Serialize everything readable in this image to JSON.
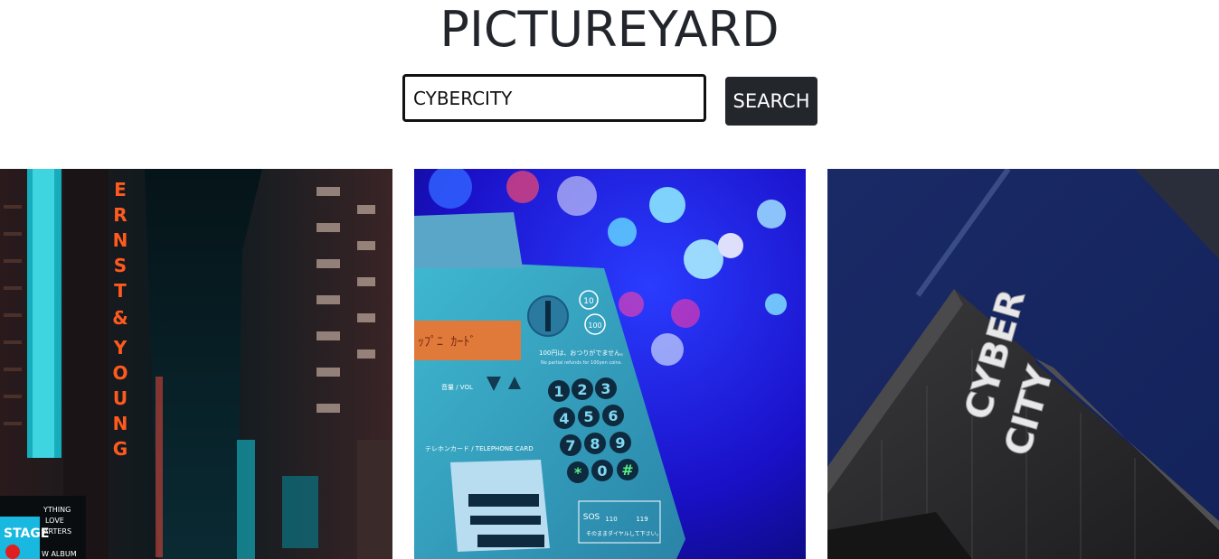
{
  "header": {
    "title": "PICTUREYARD"
  },
  "search": {
    "value": "CYBERCITY",
    "button_label": "SEARCH"
  },
  "results": {
    "photos": [
      {
        "subject": "neon city street at night",
        "sign_text": [
          "E",
          "R",
          "N",
          "S",
          "T",
          "&",
          "Y",
          "O",
          "U",
          "N",
          "G"
        ],
        "billboard_text": [
          "YTHING",
          "LOVE",
          "ARTERS",
          "W ALBUM"
        ],
        "stage_text": "STAGE"
      },
      {
        "subject": "public telephone keypad",
        "keys": [
          "1",
          "2",
          "3",
          "4",
          "5",
          "6",
          "7",
          "8",
          "9",
          "*",
          "0",
          "#"
        ],
        "card_label": "テレホンカード / TELEPHONE CARD",
        "vol_label": "音量 / VOL",
        "coin_labels": [
          "10",
          "100"
        ],
        "instruction": "100円は、おつりがでません。",
        "instruction_en": "No partial refunds for 100yen coins.",
        "sos_label": "SOS",
        "sos_numbers": [
          "110",
          "119"
        ],
        "bottom_note": "そのままダイヤルして下さい。"
      },
      {
        "subject": "building facade with sign",
        "sign_text": [
          "CYBER",
          "CITY"
        ]
      }
    ]
  }
}
